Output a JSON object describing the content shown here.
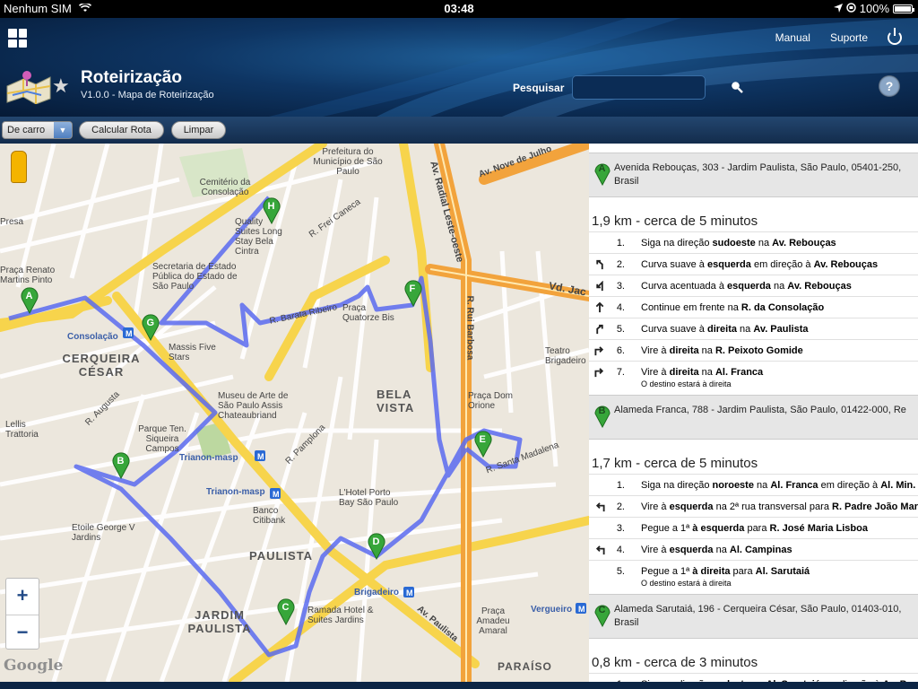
{
  "status_bar": {
    "carrier": "Nenhum SIM",
    "time": "03:48",
    "battery": "100%"
  },
  "header": {
    "manual": "Manual",
    "support": "Suporte",
    "app_title": "Roteirização",
    "app_subtitle": "V1.0.0 - Mapa de Roteirização",
    "search_label": "Pesquisar",
    "search_value": "",
    "help": "?"
  },
  "toolbar": {
    "mode": "De carro",
    "calc": "Calcular Rota",
    "clear": "Limpar"
  },
  "map": {
    "labels": {
      "cemiterio": "Cemitério da Consolação",
      "prefeitura": "Prefeitura do Município de São Paulo",
      "quality": "Quality Suites Long Stay Bela Cintra",
      "secretaria": "Secretaria de Estado Pública do Estado de São Paulo",
      "consolacao": "Consolação",
      "cerqueira": "CERQUEIRA CÉSAR",
      "massis": "Massis Five Stars",
      "masp": "Museu de Arte de São Paulo Assis Chateaubriand",
      "bela_vista": "BELA VISTA",
      "quatorze": "Praça Quatorze Bis",
      "dom_orione": "Praça Dom Orione",
      "teatro": "Teatro Brigadeiro",
      "trianon": "Trianon-masp",
      "parque": "Parque Ten. Siqueira Campos",
      "lellis": "Lellis Trattoria",
      "etoile": "Etoile George V Jardins",
      "hotel_porto": "L'Hotel Porto Bay São Paulo",
      "banco": "Banco Citibank",
      "paulista": "PAULISTA",
      "brigadeiro": "Brigadeiro",
      "jardim": "JARDIM PAULISTA",
      "ramada": "Ramada Hotel & Suites Jardins",
      "amadeu": "Praça Amadeu Amaral",
      "vergueiro": "Vergueiro",
      "paraiso": "PARAÍSO",
      "av_paulista": "Av. Paulista",
      "radial": "Av. Radial Leste-oeste",
      "nove_julho": "Av. Nove de Julho",
      "vd_jac": "Vd. Jac",
      "rui_barbosa": "R. Rui Barbosa",
      "pamplona": "R. Pamplona",
      "augusta": "R. Augusta",
      "santa_madalena": "R. Santa Madalena",
      "barata": "R. Barata Ribeiro",
      "caneca": "R. Frei Caneca",
      "renato": "Praça Renato Martins Pinto",
      "presa": "Presa"
    },
    "zoom_in": "+",
    "zoom_out": "−",
    "attribution": "Google"
  },
  "directions": [
    {
      "marker": "A",
      "address": "Avenida Rebouças, 303 - Jardim Paulista, São Paulo, 05401-250,",
      "address2": "Brasil",
      "summary": "1,9 km - cerca de 5 minutos",
      "steps": [
        {
          "n": "1.",
          "icon": "",
          "pre": "Siga na direção ",
          "b1": "sudoeste",
          "mid": " na ",
          "b2": "Av. Rebouças",
          "post": ""
        },
        {
          "n": "2.",
          "icon": "turn-slight-left-icon",
          "pre": "Curva suave à ",
          "b1": "esquerda",
          "mid": " em direção à ",
          "b2": "Av. Rebouças",
          "post": ""
        },
        {
          "n": "3.",
          "icon": "turn-sharp-left-icon",
          "pre": "Curva acentuada à ",
          "b1": "esquerda",
          "mid": " na ",
          "b2": "Av. Rebouças",
          "post": ""
        },
        {
          "n": "4.",
          "icon": "straight-icon",
          "pre": "Continue em frente na ",
          "b1": "R. da Consolação",
          "mid": "",
          "b2": "",
          "post": ""
        },
        {
          "n": "5.",
          "icon": "turn-slight-right-icon",
          "pre": "Curva suave à ",
          "b1": "direita",
          "mid": " na ",
          "b2": "Av. Paulista",
          "post": ""
        },
        {
          "n": "6.",
          "icon": "turn-right-icon",
          "pre": "Vire à ",
          "b1": "direita",
          "mid": " na ",
          "b2": "R. Peixoto Gomide",
          "post": ""
        },
        {
          "n": "7.",
          "icon": "turn-right-icon",
          "pre": "Vire à ",
          "b1": "direita",
          "mid": " na ",
          "b2": "Al. Franca",
          "post": "",
          "sub": "O destino estará à direita"
        }
      ]
    },
    {
      "marker": "B",
      "address": "Alameda Franca, 788 - Jardim Paulista, São Paulo, 01422-000, Re",
      "address2": "",
      "summary": "1,7 km - cerca de 5 minutos",
      "steps": [
        {
          "n": "1.",
          "icon": "",
          "pre": "Siga na direção ",
          "b1": "noroeste",
          "mid": " na ",
          "b2": "Al. Franca",
          "post": " em direção à ",
          "b3": "Al. Min."
        },
        {
          "n": "2.",
          "icon": "turn-left-icon",
          "pre": "Vire à ",
          "b1": "esquerda",
          "mid": " na 2ª rua transversal para ",
          "b2": "R. Padre João Mar",
          "post": ""
        },
        {
          "n": "3.",
          "icon": "",
          "pre": "Pegue a 1ª ",
          "b1": "à esquerda",
          "mid": " para ",
          "b2": "R. José Maria Lisboa",
          "post": ""
        },
        {
          "n": "4.",
          "icon": "turn-left-icon",
          "pre": "Vire à ",
          "b1": "esquerda",
          "mid": " na ",
          "b2": "Al. Campinas",
          "post": ""
        },
        {
          "n": "5.",
          "icon": "",
          "pre": "Pegue a 1ª ",
          "b1": "à direita",
          "mid": " para ",
          "b2": "Al. Sarutaiá",
          "post": "",
          "sub": "O destino estará à direita"
        }
      ]
    },
    {
      "marker": "C",
      "address": "Alameda Sarutaiá, 196 - Cerqueira César, São Paulo, 01403-010,",
      "address2": "Brasil",
      "summary": "0,8 km - cerca de 3 minutos",
      "steps": [
        {
          "n": "1.",
          "icon": "",
          "pre": "Siga na direção ",
          "b1": "sudeste",
          "mid": " na ",
          "b2": "Al. Sarutaiá",
          "post": " em direção à ",
          "b3": "Av. Brg"
        }
      ]
    }
  ],
  "route_markers": [
    "A",
    "B",
    "C",
    "D",
    "E",
    "F",
    "G",
    "H"
  ],
  "colors": {
    "route": "#5b6bf0",
    "marker": "#2e9a2e",
    "major_road": "#f7d44c",
    "highway": "#f2a33c"
  }
}
